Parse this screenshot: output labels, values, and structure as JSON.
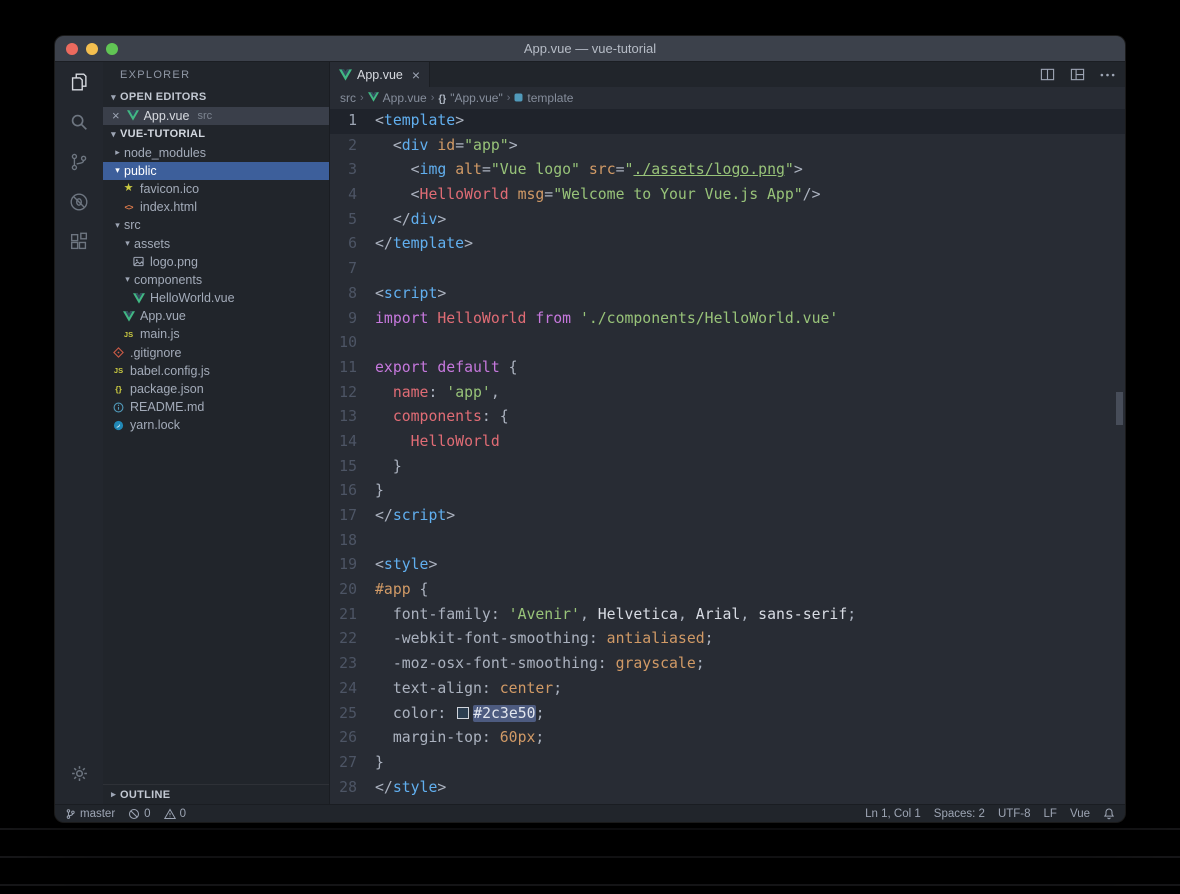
{
  "window": {
    "title": "App.vue — vue-tutorial"
  },
  "activity_bar": {
    "items": [
      "explorer",
      "search",
      "source-control",
      "debug",
      "extensions"
    ],
    "active": "explorer",
    "bottom": [
      "settings"
    ]
  },
  "sidebar": {
    "title": "EXPLORER",
    "open_editors": {
      "label": "OPEN EDITORS",
      "items": [
        {
          "name": "App.vue",
          "detail": "src",
          "icon": "vue"
        }
      ]
    },
    "project_label": "VUE-TUTORIAL",
    "outline_label": "OUTLINE",
    "tree": [
      {
        "name": "node_modules",
        "kind": "folder",
        "state": "collapsed",
        "depth": 0
      },
      {
        "name": "public",
        "kind": "folder",
        "state": "expanded",
        "depth": 0,
        "selected": true
      },
      {
        "name": "favicon.ico",
        "kind": "file",
        "icon": "star",
        "depth": 1
      },
      {
        "name": "index.html",
        "kind": "file",
        "icon": "html",
        "depth": 1
      },
      {
        "name": "src",
        "kind": "folder",
        "state": "expanded",
        "depth": 0
      },
      {
        "name": "assets",
        "kind": "folder",
        "state": "expanded",
        "depth": 1
      },
      {
        "name": "logo.png",
        "kind": "file",
        "icon": "image",
        "depth": 2
      },
      {
        "name": "components",
        "kind": "folder",
        "state": "expanded",
        "depth": 1
      },
      {
        "name": "HelloWorld.vue",
        "kind": "file",
        "icon": "vue",
        "depth": 2
      },
      {
        "name": "App.vue",
        "kind": "file",
        "icon": "vue",
        "depth": 1
      },
      {
        "name": "main.js",
        "kind": "file",
        "icon": "js",
        "depth": 1
      },
      {
        "name": ".gitignore",
        "kind": "file",
        "icon": "git",
        "depth": 0
      },
      {
        "name": "babel.config.js",
        "kind": "file",
        "icon": "js",
        "depth": 0
      },
      {
        "name": "package.json",
        "kind": "file",
        "icon": "json",
        "depth": 0
      },
      {
        "name": "README.md",
        "kind": "file",
        "icon": "info",
        "depth": 0
      },
      {
        "name": "yarn.lock",
        "kind": "file",
        "icon": "yarn",
        "depth": 0
      }
    ]
  },
  "editor": {
    "tab": {
      "label": "App.vue"
    },
    "actions": [
      "split-editor",
      "toggle-layout",
      "more-actions"
    ],
    "breadcrumbs": [
      {
        "label": "src"
      },
      {
        "label": "App.vue",
        "icon": "vue"
      },
      {
        "label": "\"App.vue\"",
        "icon": "braces"
      },
      {
        "label": "template",
        "icon": "symbol"
      }
    ],
    "active_line": 1,
    "lines": [
      [
        [
          "pun",
          "<"
        ],
        [
          "tag",
          "template"
        ],
        [
          "pun",
          ">"
        ]
      ],
      [
        [
          "pun",
          "  <"
        ],
        [
          "tag",
          "div"
        ],
        [
          "pun",
          " "
        ],
        [
          "att",
          "id"
        ],
        [
          "pun",
          "="
        ],
        [
          "str",
          "\"app\""
        ],
        [
          "pun",
          ">"
        ]
      ],
      [
        [
          "pun",
          "    <"
        ],
        [
          "tag",
          "img"
        ],
        [
          "pun",
          " "
        ],
        [
          "att",
          "alt"
        ],
        [
          "pun",
          "="
        ],
        [
          "str",
          "\"Vue logo\""
        ],
        [
          "pun",
          " "
        ],
        [
          "att",
          "src"
        ],
        [
          "pun",
          "="
        ],
        [
          "str",
          "\""
        ],
        [
          "lnk",
          "./assets/logo.png"
        ],
        [
          "str",
          "\""
        ],
        [
          "pun",
          ">"
        ]
      ],
      [
        [
          "pun",
          "    <"
        ],
        [
          "cmp",
          "HelloWorld"
        ],
        [
          "pun",
          " "
        ],
        [
          "att",
          "msg"
        ],
        [
          "pun",
          "="
        ],
        [
          "str",
          "\"Welcome to Your Vue.js App\""
        ],
        [
          "pun",
          "/>"
        ]
      ],
      [
        [
          "pun",
          "  </"
        ],
        [
          "tag",
          "div"
        ],
        [
          "pun",
          ">"
        ]
      ],
      [
        [
          "pun",
          "</"
        ],
        [
          "tag",
          "template"
        ],
        [
          "pun",
          ">"
        ]
      ],
      [],
      [
        [
          "pun",
          "<"
        ],
        [
          "tag",
          "script"
        ],
        [
          "pun",
          ">"
        ]
      ],
      [
        [
          "kw",
          "import"
        ],
        [
          "pun",
          " "
        ],
        [
          "cmp",
          "HelloWorld"
        ],
        [
          "pun",
          " "
        ],
        [
          "kw",
          "from"
        ],
        [
          "pun",
          " "
        ],
        [
          "str",
          "'./components/HelloWorld.vue'"
        ]
      ],
      [],
      [
        [
          "kw",
          "export"
        ],
        [
          "pun",
          " "
        ],
        [
          "kw",
          "default"
        ],
        [
          "pun",
          " {"
        ]
      ],
      [
        [
          "pun",
          "  "
        ],
        [
          "key",
          "name"
        ],
        [
          "pun",
          ": "
        ],
        [
          "str",
          "'app'"
        ],
        [
          "pun",
          ","
        ]
      ],
      [
        [
          "pun",
          "  "
        ],
        [
          "key",
          "components"
        ],
        [
          "pun",
          ": {"
        ]
      ],
      [
        [
          "pun",
          "    "
        ],
        [
          "cmp",
          "HelloWorld"
        ]
      ],
      [
        [
          "pun",
          "  }"
        ]
      ],
      [
        [
          "pun",
          "}"
        ]
      ],
      [
        [
          "pun",
          "</"
        ],
        [
          "tag",
          "script"
        ],
        [
          "pun",
          ">"
        ]
      ],
      [],
      [
        [
          "pun",
          "<"
        ],
        [
          "tag",
          "style"
        ],
        [
          "pun",
          ">"
        ]
      ],
      [
        [
          "sel",
          "#app"
        ],
        [
          "pun",
          " {"
        ]
      ],
      [
        [
          "pun",
          "  "
        ],
        [
          "prop",
          "font-family"
        ],
        [
          "pun",
          ": "
        ],
        [
          "str",
          "'Avenir'"
        ],
        [
          "pun",
          ", "
        ],
        [
          "wht",
          "Helvetica"
        ],
        [
          "pun",
          ", "
        ],
        [
          "wht",
          "Arial"
        ],
        [
          "pun",
          ", "
        ],
        [
          "wht",
          "sans-serif"
        ],
        [
          "pun",
          ";"
        ]
      ],
      [
        [
          "pun",
          "  "
        ],
        [
          "prop",
          "-webkit-font-smoothing"
        ],
        [
          "pun",
          ": "
        ],
        [
          "val",
          "antialiased"
        ],
        [
          "pun",
          ";"
        ]
      ],
      [
        [
          "pun",
          "  "
        ],
        [
          "prop",
          "-moz-osx-font-smoothing"
        ],
        [
          "pun",
          ": "
        ],
        [
          "val",
          "grayscale"
        ],
        [
          "pun",
          ";"
        ]
      ],
      [
        [
          "pun",
          "  "
        ],
        [
          "prop",
          "text-align"
        ],
        [
          "pun",
          ": "
        ],
        [
          "val",
          "center"
        ],
        [
          "pun",
          ";"
        ]
      ],
      [
        [
          "pun",
          "  "
        ],
        [
          "prop",
          "color"
        ],
        [
          "pun",
          ": "
        ],
        [
          "swatch",
          ""
        ],
        [
          "hlv",
          "#2c3e50"
        ],
        [
          "pun",
          ";"
        ]
      ],
      [
        [
          "pun",
          "  "
        ],
        [
          "prop",
          "margin-top"
        ],
        [
          "pun",
          ": "
        ],
        [
          "val",
          "60px"
        ],
        [
          "pun",
          ";"
        ]
      ],
      [
        [
          "pun",
          "}"
        ]
      ],
      [
        [
          "pun",
          "</"
        ],
        [
          "tag",
          "style"
        ],
        [
          "pun",
          ">"
        ]
      ]
    ]
  },
  "status_bar": {
    "left": [
      {
        "name": "branch",
        "icon": "branch",
        "label": "master"
      },
      {
        "name": "errors",
        "icon": "error",
        "label": "0"
      },
      {
        "name": "warnings",
        "icon": "warning",
        "label": "0"
      }
    ],
    "right": [
      {
        "name": "cursor-position",
        "label": "Ln 1, Col 1"
      },
      {
        "name": "indentation",
        "label": "Spaces: 2"
      },
      {
        "name": "encoding",
        "label": "UTF-8"
      },
      {
        "name": "eol",
        "label": "LF"
      },
      {
        "name": "language-mode",
        "label": "Vue"
      },
      {
        "name": "notifications",
        "icon": "bell",
        "label": ""
      }
    ]
  },
  "colors": {
    "editor_bg": "#282c34",
    "sidebar_bg": "#21252b",
    "titlebar_bg": "#3c414b",
    "selection_blue": "#3d5f9b",
    "vue_green": "#41b883",
    "accent_blue": "#61afef",
    "swatch": "#2c3e50"
  }
}
